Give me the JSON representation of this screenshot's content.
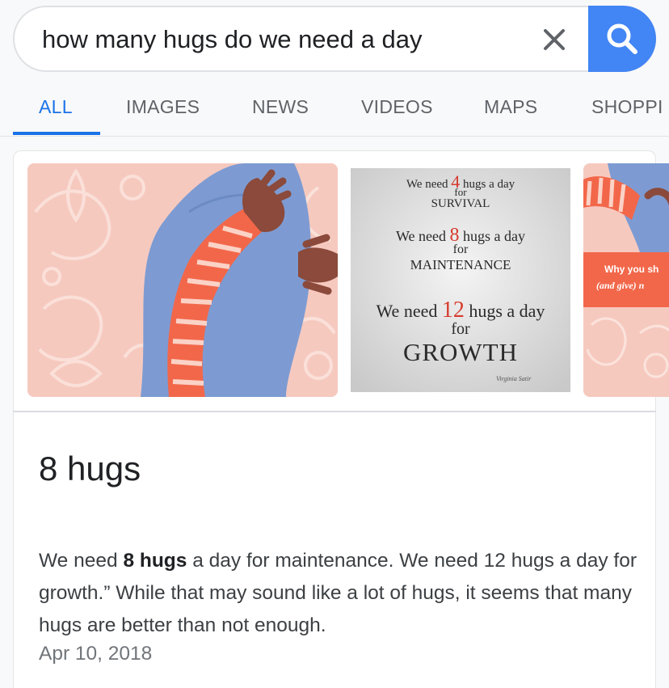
{
  "search": {
    "query": "how many hugs do we need a day"
  },
  "tabs": [
    {
      "label": "ALL",
      "active": true
    },
    {
      "label": "IMAGES",
      "active": false
    },
    {
      "label": "NEWS",
      "active": false
    },
    {
      "label": "VIDEOS",
      "active": false
    },
    {
      "label": "MAPS",
      "active": false
    },
    {
      "label": "SHOPPI",
      "active": false
    }
  ],
  "images": {
    "poster": {
      "line1_pre": "We need",
      "line1_num": "4",
      "line1_post": "hugs a day",
      "line1_for": "for",
      "line1_word": "SURVIVAL",
      "line2_pre": "We need",
      "line2_num": "8",
      "line2_post": "hugs a day",
      "line2_for": "for",
      "line2_word": "MAINTENANCE",
      "line3_pre": "We need",
      "line3_num": "12",
      "line3_post": "hugs a day",
      "line3_for": "for",
      "line3_word": "GROWTH",
      "signature": "Virginia Satir"
    },
    "third_caption_line1": "Why you sh",
    "third_caption_line2": "(and give) n"
  },
  "answer": {
    "title": "8 hugs",
    "snippet_pre": "We need ",
    "snippet_bold": "8 hugs",
    "snippet_post": " a day for maintenance. We need 12 hugs a day for growth.” While that may sound like a lot of hugs, it seems that many hugs are better than not enough.",
    "date": "Apr 10, 2018"
  },
  "colors": {
    "accent_blue": "#1a73e8",
    "search_button": "#4285f4",
    "coral": "#f2674a",
    "pink_bg": "#f6c9bf",
    "hug_blue": "#7d9bd2",
    "poster_red": "#d63b2d"
  }
}
